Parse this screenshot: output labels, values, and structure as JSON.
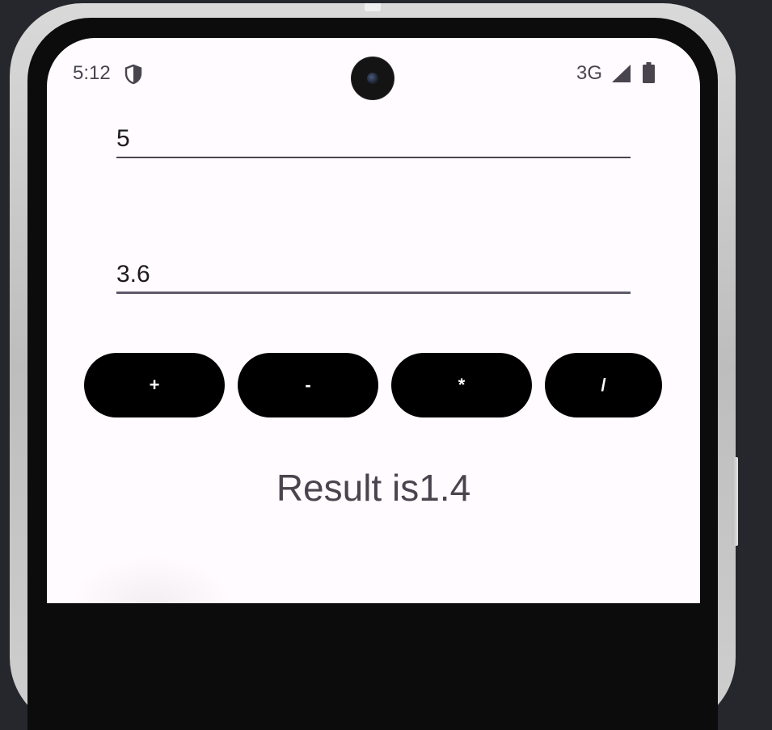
{
  "app": {
    "first_number": "5",
    "second_number": "3.6",
    "result_text": "Result is1.4"
  },
  "status_bar": {
    "time": "5:12",
    "network": "3G",
    "icons": [
      "shield-icon",
      "signal-icon",
      "battery-icon"
    ]
  },
  "operators": {
    "add_label": "+",
    "subtract_label": "-",
    "multiply_label": "*",
    "divide_label": "/"
  },
  "colors": {
    "screen_background": "#fffbfe",
    "button_background": "#000000",
    "button_text": "#ffffff",
    "text_secondary": "#49454f"
  }
}
